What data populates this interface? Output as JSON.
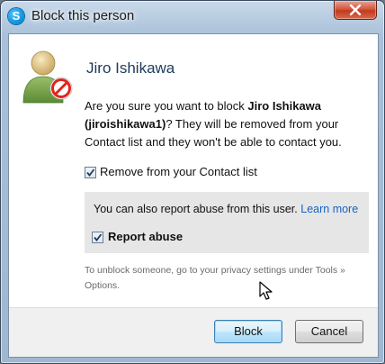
{
  "window": {
    "title": "Block this person",
    "app_icon_letter": "S",
    "close_icon": "close-icon"
  },
  "dialog": {
    "contact_name": "Jiro Ishikawa",
    "question_prefix": "Are you sure you want to block ",
    "question_name": "Jiro Ishikawa",
    "question_handle": "(jiroishikawa1)",
    "question_suffix": "? They will be removed from your Contact list and they won't be able to contact you.",
    "remove_checkbox": {
      "label": "Remove from your Contact list",
      "checked": true
    },
    "report": {
      "text": "You can also report abuse from this user.",
      "link": "Learn more",
      "checkbox_label": "Report abuse",
      "checked": true
    },
    "unblock_note": "To unblock someone, go to your privacy settings under Tools » Options."
  },
  "buttons": {
    "block": "Block",
    "cancel": "Cancel"
  },
  "colors": {
    "heading": "#1e395b",
    "link": "#1565c0",
    "block_icon": "#e2241b"
  }
}
